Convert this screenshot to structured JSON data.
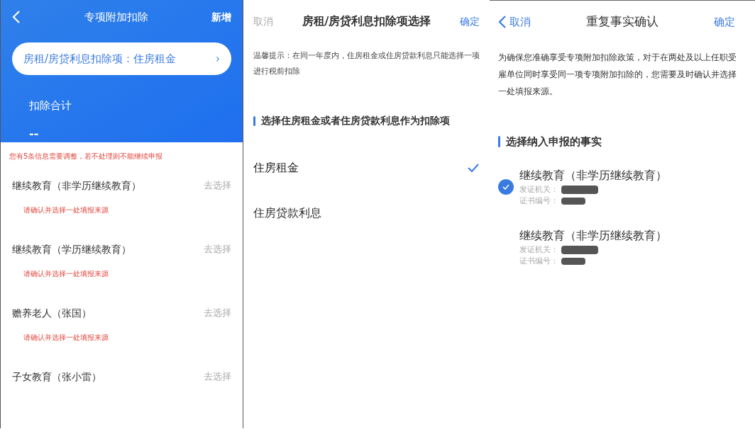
{
  "panels": [
    {
      "kind": "list",
      "header": {
        "title": "专项附加扣除",
        "action": "新增"
      },
      "summary_pill": {
        "label": "房租/房贷利息扣除项：住房租金",
        "arrow": "›"
      },
      "total": {
        "label": "扣除合计",
        "value": "--"
      },
      "warning": "您有5条信息需要调整，若不处理则不能继续申报",
      "items": [
        {
          "title": "继续教育（非学历继续教育）",
          "action": "去选择",
          "note": "请确认并选择一处填报来源"
        },
        {
          "title": "继续教育（学历继续教育）",
          "action": "去选择",
          "note": "请确认并选择一处填报来源"
        },
        {
          "title": "赡养老人（张国）",
          "action": "去选择",
          "note": "请确认并选择一处填报来源"
        },
        {
          "title": "子女教育（张小雷）",
          "action": "去选择"
        }
      ]
    },
    {
      "kind": "choice",
      "header": {
        "cancel": "取消",
        "title": "房租/房贷利息扣除项选择",
        "confirm": "确定"
      },
      "tip": "温馨提示：在同一年度内，住房租金或住房贷款利息只能选择一项进行税前扣除",
      "section": "选择住房租金或者住房贷款利息作为扣除项",
      "options": [
        {
          "label": "住房租金",
          "selected": true
        },
        {
          "label": "住房贷款利息",
          "selected": false
        }
      ]
    },
    {
      "kind": "facts",
      "header": {
        "cancel": "取消",
        "title": "重复事实确认",
        "confirm": "确定"
      },
      "intro": "为确保您准确享受专项附加扣除政策，对于在两处及以上任职受雇单位同时享受同一项专项附加扣除的，您需要及时确认并选择一处填报来源。",
      "section": "选择纳入申报的事实",
      "facts": [
        {
          "title": "继续教育（非学历继续教育）",
          "issuer_label": "发证机关：",
          "number_label": "证书编号：",
          "selected": true
        },
        {
          "title": "继续教育（非学历继续教育）",
          "issuer_label": "发证机关：",
          "number_label": "证书编号：",
          "selected": false
        }
      ]
    }
  ]
}
